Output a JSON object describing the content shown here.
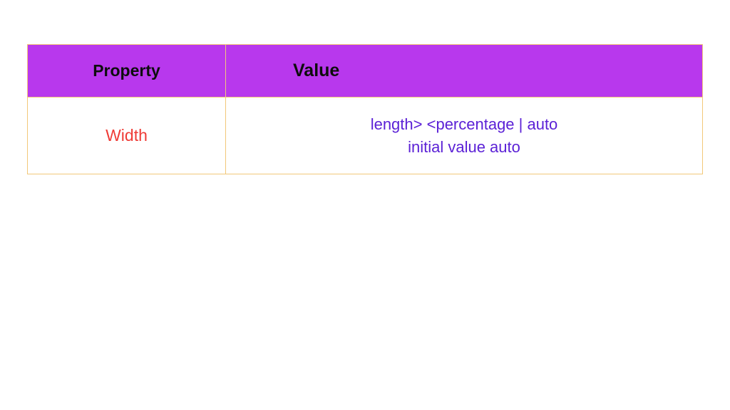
{
  "table": {
    "headers": {
      "property": "Property",
      "value": "Value"
    },
    "row": {
      "property": "Width",
      "value_line1": "length> <percentage | auto",
      "value_line2": "initial value auto"
    }
  }
}
